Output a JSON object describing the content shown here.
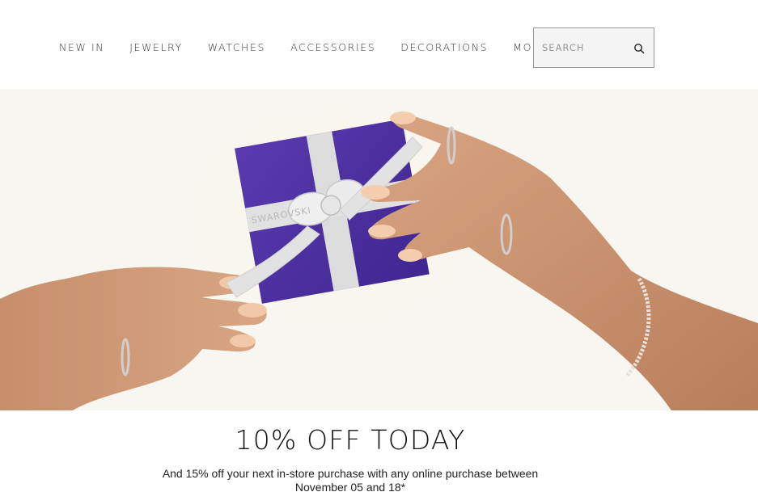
{
  "nav": {
    "items": [
      {
        "label": "NEW IN"
      },
      {
        "label": "JEWELRY"
      },
      {
        "label": "WATCHES"
      },
      {
        "label": "ACCESSORIES"
      },
      {
        "label": "DECORATIONS"
      },
      {
        "label": "MORE"
      }
    ]
  },
  "search": {
    "placeholder": "SEARCH",
    "icon": "search-icon"
  },
  "hero": {
    "ribbon_text_1": "SWAROVSKI",
    "ribbon_text_2": "SWA",
    "box_color": "#4b2f9e",
    "ribbon_color": "#dcdcdc"
  },
  "promo": {
    "title": "10% OFF TODAY",
    "subtitle": "And 15% off your next in-store purchase with any online purchase between November 05 and 18*"
  }
}
